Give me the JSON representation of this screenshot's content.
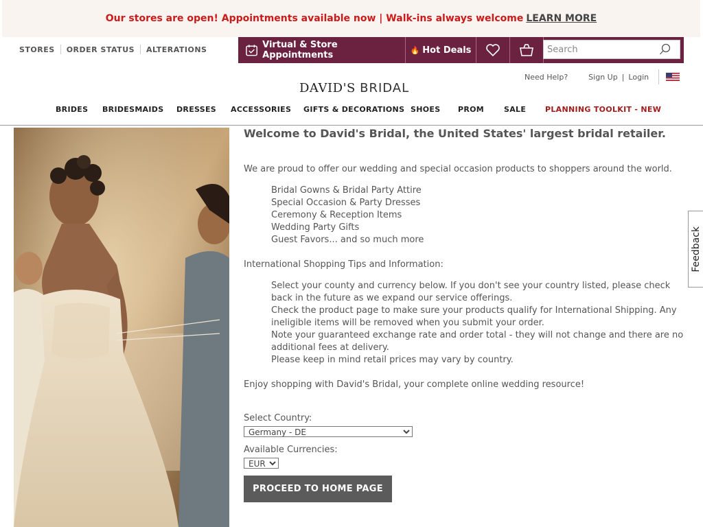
{
  "promo": {
    "text": "Our stores are open! Appointments available now | Walk-ins always welcome",
    "link": "LEARN MORE"
  },
  "utility_links": [
    "STORES",
    "ORDER STATUS",
    "ALTERATIONS"
  ],
  "topbar": {
    "appointments": "Virtual & Store Appointments",
    "hot_deals": "Hot Deals",
    "search_placeholder": "Search"
  },
  "account": {
    "help": "Need Help?",
    "sign_up": "Sign Up",
    "separator": "|",
    "login": "Login"
  },
  "logo": {
    "brand": "DAVID'S",
    "sub": "BRIDAL"
  },
  "nav": [
    "BRIDES",
    "BRIDESMAIDS",
    "DRESSES",
    "ACCESSORIES",
    "GIFTS & DECORATIONS",
    "SHOES",
    "PROM",
    "SALE",
    "PLANNING TOOLKIT - NEW"
  ],
  "main": {
    "welcome": "Welcome to David's Bridal, the United States' largest bridal retailer.",
    "intro": "We are proud to offer our wedding and special occasion products to shoppers around the world.",
    "products": [
      "Bridal Gowns & Bridal Party Attire",
      "Special Occasion & Party Dresses",
      "Ceremony & Reception Items",
      "Wedding Party Gifts",
      "Guest Favors... and so much more"
    ],
    "tips_title": "International Shopping Tips and Information:",
    "tips": [
      "Select your county and currency below. If you don't see your country listed, please check back in the future as we expand our service offerings.",
      "Check the product page to make sure your products qualify for International Shipping. Any ineligible items will be removed when you submit your order.",
      "Note your guaranteed exchange rate and order total - they will not change and there are no additional fees at delivery.",
      "Please keep in mind retail prices may vary by country."
    ],
    "enjoy": "Enjoy shopping with David's Bridal, your complete online wedding resource!",
    "country_label": "Select Country:",
    "country_value": "Germany - DE",
    "currency_label": "Available Currencies:",
    "currency_value": "EUR",
    "proceed": "PROCEED TO HOME PAGE"
  },
  "feedback": "Feedback",
  "colors": {
    "promo_text": "#cc1a1a",
    "topbar_bg": "#6b2240",
    "planning_link": "#a31b1b",
    "button_bg": "#5b5b5b"
  }
}
